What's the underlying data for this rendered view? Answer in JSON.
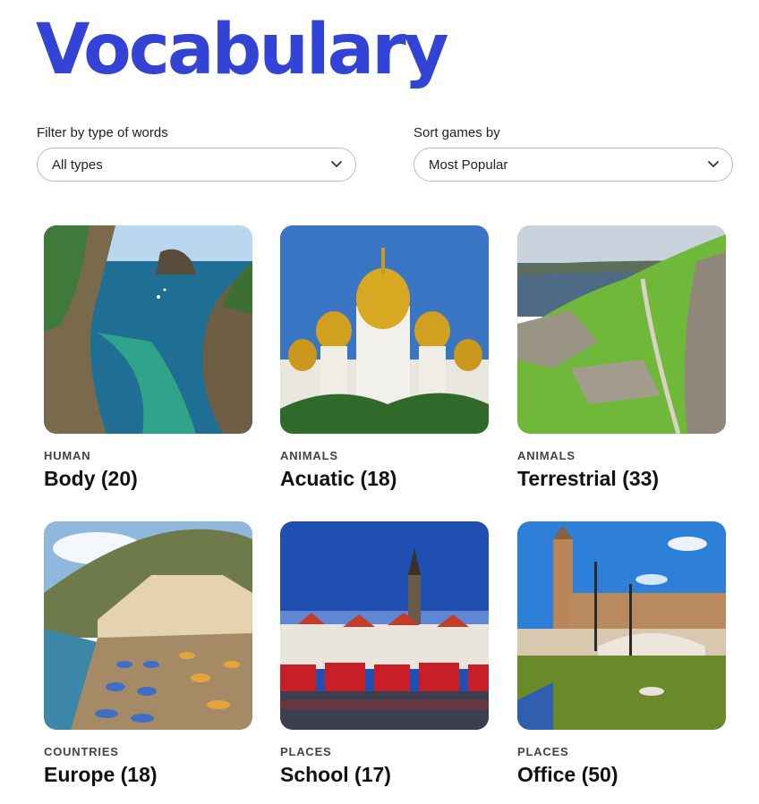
{
  "page": {
    "title": "Vocabulary"
  },
  "filters": {
    "type_label": "Filter by type of words",
    "type_value": "All types",
    "sort_label": "Sort games by",
    "sort_value": "Most Popular"
  },
  "cards": [
    {
      "category": "HUMAN",
      "title": "Body (20)",
      "image": "coastal-cove-photo"
    },
    {
      "category": "ANIMALS",
      "title": "Acuatic (18)",
      "image": "golden-domes-photo"
    },
    {
      "category": "ANIMALS",
      "title": "Terrestrial (33)",
      "image": "castle-ruins-photo"
    },
    {
      "category": "COUNTRIES",
      "title": "Europe (18)",
      "image": "beach-umbrellas-photo"
    },
    {
      "category": "PLACES",
      "title": "School (17)",
      "image": "red-houses-harbor-photo"
    },
    {
      "category": "PLACES",
      "title": "Office (50)",
      "image": "plaza-bridge-photo"
    }
  ],
  "colors": {
    "accent": "#3343d6"
  }
}
